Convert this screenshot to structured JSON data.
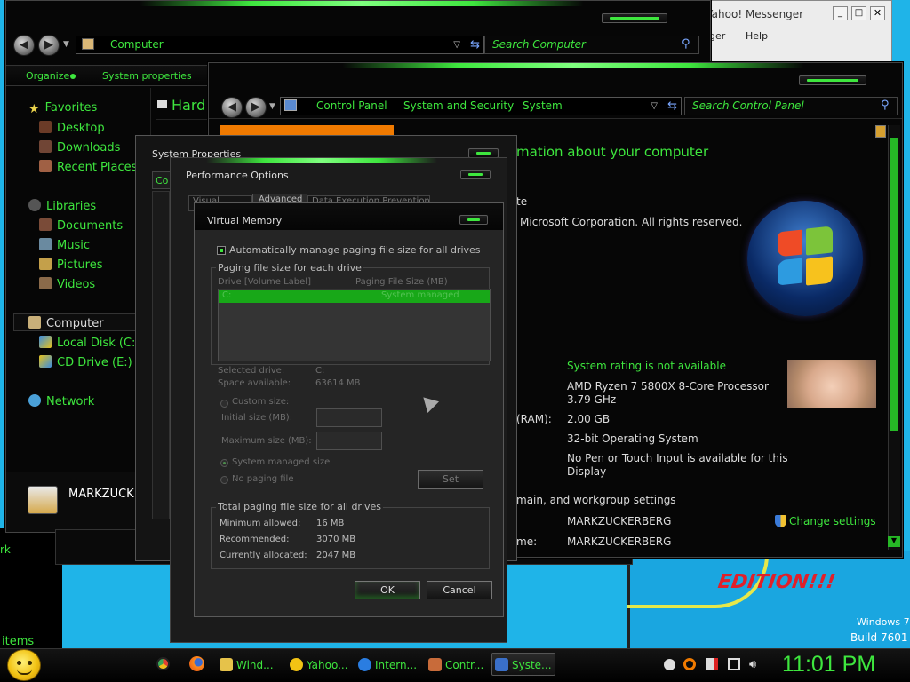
{
  "desktop": {
    "slogan": "EDITION!!!",
    "os_name": "Windows 7",
    "build": "Build 7601",
    "partial_left_1": "rk",
    "partial_left_2": "items"
  },
  "messenger": {
    "title": "Yahoo! Messenger",
    "menu_1": "nger",
    "menu_2": "Help"
  },
  "explorer": {
    "breadcrumb": "Computer",
    "search_placeholder": "Search Computer",
    "toolbar": {
      "organize": "Organize",
      "system_properties": "System properties"
    },
    "header_partial": "Hard D",
    "nav": {
      "favorites": "Favorites",
      "desktop": "Desktop",
      "downloads": "Downloads",
      "recent_places": "Recent Places",
      "libraries": "Libraries",
      "documents": "Documents",
      "music": "Music",
      "pictures": "Pictures",
      "videos": "Videos",
      "computer": "Computer",
      "local_disk": "Local Disk (C:)",
      "cd_drive": "CD Drive (E:)",
      "network": "Network"
    },
    "user_name": "MARKZUCK"
  },
  "control_panel": {
    "breadcrumb": [
      "Control Panel",
      "System and Security",
      "System"
    ],
    "search_placeholder": "Search Control Panel",
    "heading": "mation about your computer",
    "copyright_partial": "te",
    "copyright": "Microsoft Corporation.  All rights reserved.",
    "rating": "System rating is not available",
    "processor_1": "AMD Ryzen 7 5800X 8-Core Processor",
    "processor_2": "3.79 GHz",
    "ram_label": "(RAM):",
    "ram": "2.00 GB",
    "system_type": "32-bit Operating System",
    "pen_1": "No Pen or Touch Input is available for this",
    "pen_2": "Display",
    "domain_heading": "main, and workgroup settings",
    "computer_name": "MARKZUCKERBERG",
    "full_name_label": "me:",
    "full_name": "MARKZUCKERBERG",
    "change_settings": "Change settings"
  },
  "system_properties": {
    "title": "System Properties",
    "tab_partial": "Co"
  },
  "performance_options": {
    "title": "Performance Options",
    "tabs": [
      "Visual Effects",
      "Advanced",
      "Data Execution Prevention"
    ]
  },
  "virtual_memory": {
    "title": "Virtual Memory",
    "auto_manage": "Automatically manage paging file size for all drives",
    "group_paging": "Paging file size for each drive",
    "col_drive": "Drive [Volume Label]",
    "col_size": "Paging File Size (MB)",
    "row_drive": "C:",
    "row_size": "System managed",
    "selected_drive_label": "Selected drive:",
    "selected_drive": "C:",
    "space_label": "Space available:",
    "space": "63614 MB",
    "custom_size": "Custom size:",
    "initial_size": "Initial size (MB):",
    "maximum_size": "Maximum size (MB):",
    "system_managed": "System managed size",
    "no_paging": "No paging file",
    "set": "Set",
    "group_total": "Total paging file size for all drives",
    "min_label": "Minimum allowed:",
    "min": "16 MB",
    "rec_label": "Recommended:",
    "rec": "3070 MB",
    "cur_label": "Currently allocated:",
    "cur": "2047 MB",
    "ok": "OK",
    "cancel": "Cancel"
  },
  "taskbar": {
    "items": [
      "Wind...",
      "Yahoo...",
      "Intern...",
      "Contr...",
      "Syste..."
    ],
    "clock": "11:01 PM"
  }
}
